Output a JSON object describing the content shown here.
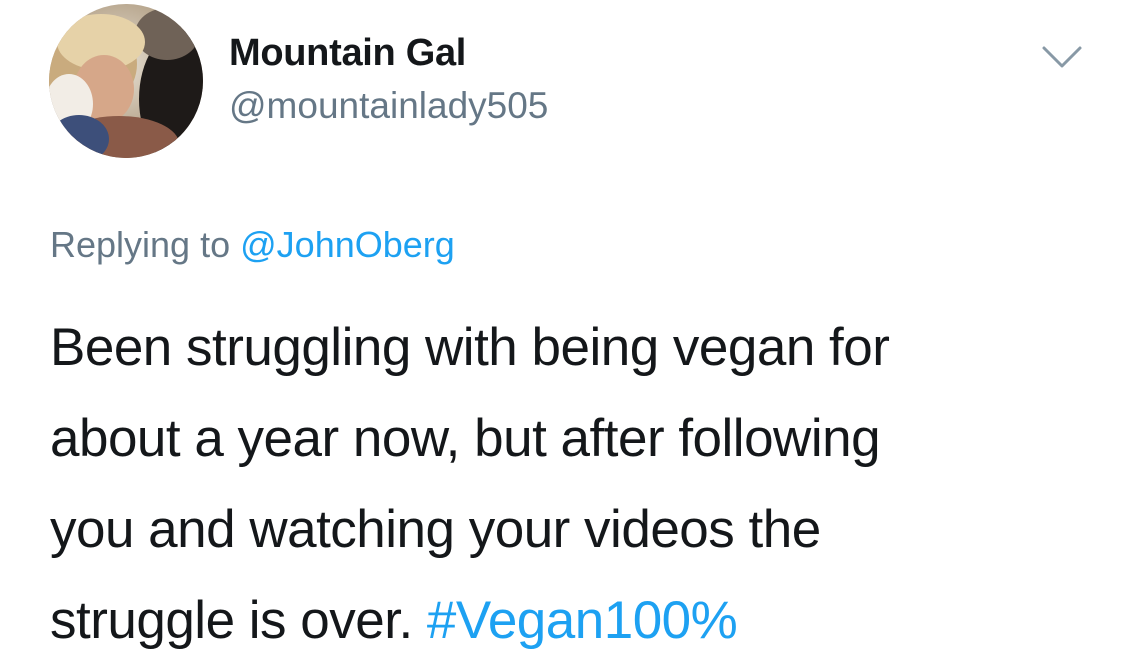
{
  "tweet": {
    "author": {
      "display_name": "Mountain Gal",
      "handle": "@mountainlady505",
      "avatar_icon": "profile-photo"
    },
    "menu_icon": "chevron-down-icon",
    "reply_context": {
      "prefix": "Replying to",
      "mention": "@JohnOberg"
    },
    "text_lines": [
      "Been struggling with being vegan for",
      "about a year now, but after following",
      "you and watching your videos the",
      "struggle is over."
    ],
    "hashtag": "#Vegan100%"
  },
  "colors": {
    "text": "#14171a",
    "secondary": "#657786",
    "link": "#1da1f2"
  }
}
